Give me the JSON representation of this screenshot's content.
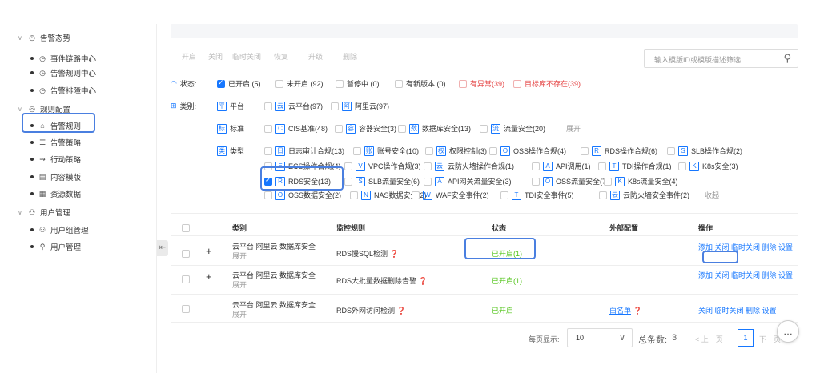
{
  "sidebar": {
    "sections": [
      {
        "label": "告警态势",
        "icon": "clock-icon",
        "children": [
          "事件链路中心",
          "告警规则中心",
          "告警排障中心"
        ]
      },
      {
        "label": "规则配置",
        "icon": "target-icon",
        "children": [
          "告警规则",
          "告警策略",
          "行动策略",
          "内容模版",
          "资源数据"
        ]
      },
      {
        "label": "用户管理",
        "icon": "users-icon",
        "children": [
          "用户组管理",
          "用户管理"
        ]
      }
    ]
  },
  "toolbar": {
    "buttons": [
      "开启",
      "关闭",
      "临时关闭",
      "恢复",
      "升级",
      "删除"
    ],
    "search_placeholder": "输入模版ID或模版描述筛选"
  },
  "filters": {
    "status_label": "状态:",
    "status_options": [
      {
        "label": "已开启 (5)",
        "checked": true,
        "tone": "normal"
      },
      {
        "label": "未开启 (92)",
        "checked": false,
        "tone": "normal"
      },
      {
        "label": "暂停中 (0)",
        "checked": false,
        "tone": "normal"
      },
      {
        "label": "有新版本 (0)",
        "checked": false,
        "tone": "normal"
      },
      {
        "label": "有异常(39)",
        "checked": false,
        "tone": "red"
      },
      {
        "label": "目标库不存在(39)",
        "checked": false,
        "tone": "red"
      }
    ],
    "category_label": "类别:",
    "platform": {
      "tag": "平",
      "label": "平台",
      "options": [
        {
          "tag": "云",
          "label": "云平台(97)"
        },
        {
          "tag": "阿",
          "label": "阿里云(97)"
        }
      ]
    },
    "standard": {
      "tag": "标",
      "label": "标准",
      "options": [
        {
          "tag": "C",
          "label": "CIS基准(48)"
        },
        {
          "tag": "容",
          "label": "容器安全(3)"
        },
        {
          "tag": "数",
          "label": "数据库安全(13)"
        },
        {
          "tag": "流",
          "label": "流量安全(20)"
        }
      ],
      "more": "展开"
    },
    "type": {
      "tag": "类",
      "label": "类型",
      "row1": [
        {
          "tag": "日",
          "label": "日志审计合规(13)"
        },
        {
          "tag": "账",
          "label": "账号安全(10)"
        },
        {
          "tag": "权",
          "label": "权限控制(3)"
        },
        {
          "tag": "O",
          "label": "OSS操作合规(4)"
        },
        {
          "tag": "R",
          "label": "RDS操作合规(6)"
        },
        {
          "tag": "S",
          "label": "SLB操作合规(2)"
        }
      ],
      "row2": [
        {
          "tag": "E",
          "label": "ECS操作合规(4)"
        },
        {
          "tag": "V",
          "label": "VPC操作合规(3)"
        },
        {
          "tag": "云",
          "label": "云防火墙操作合规(1)"
        },
        {
          "tag": "A",
          "label": "API调用(1)"
        },
        {
          "tag": "T",
          "label": "TDI操作合规(1)"
        },
        {
          "tag": "K",
          "label": "K8s安全(3)"
        }
      ],
      "row3": [
        {
          "tag": "R",
          "label": "RDS安全(13)",
          "checked": true
        },
        {
          "tag": "S",
          "label": "SLB流量安全(6)"
        },
        {
          "tag": "A",
          "label": "API网关流量安全(3)"
        },
        {
          "tag": "O",
          "label": "OSS流量安全(7)"
        },
        {
          "tag": "K",
          "label": "K8s流量安全(4)"
        }
      ],
      "row4": [
        {
          "tag": "O",
          "label": "OSS数据安全(2)"
        },
        {
          "tag": "N",
          "label": "NAS数据安全(2)"
        },
        {
          "tag": "W",
          "label": "WAF安全事件(2)"
        },
        {
          "tag": "T",
          "label": "TDI安全事件(5)"
        },
        {
          "tag": "云",
          "label": "云防火墙安全事件(2)"
        }
      ],
      "collapse": "收起"
    }
  },
  "table": {
    "headers": [
      "类别",
      "监控规则",
      "状态",
      "外部配置",
      "操作"
    ],
    "rows": [
      {
        "category": "云平台 阿里云 数据库安全",
        "expand": "展开",
        "rule": "RDS慢SQL检测",
        "status": "已开启(1)",
        "external": "",
        "actions": "添加 关闭 临时关闭 删除 设置"
      },
      {
        "category": "云平台 阿里云 数据库安全",
        "expand": "展开",
        "rule": "RDS大批量数据删除告警",
        "status": "已开启(1)",
        "external": "",
        "actions": "添加 关闭 临时关闭 删除 设置"
      },
      {
        "category": "云平台 阿里云 数据库安全",
        "expand": "展开",
        "rule": "RDS外网访问检测",
        "status": "已开启",
        "external": "白名单",
        "actions": "关闭 临时关闭 删除 设置"
      }
    ]
  },
  "pagination": {
    "per_page_label": "每页显示:",
    "per_page": "10",
    "total_label": "总条数:",
    "total": "3",
    "prev": "< 上一页",
    "current": "1",
    "next": "下一页"
  }
}
